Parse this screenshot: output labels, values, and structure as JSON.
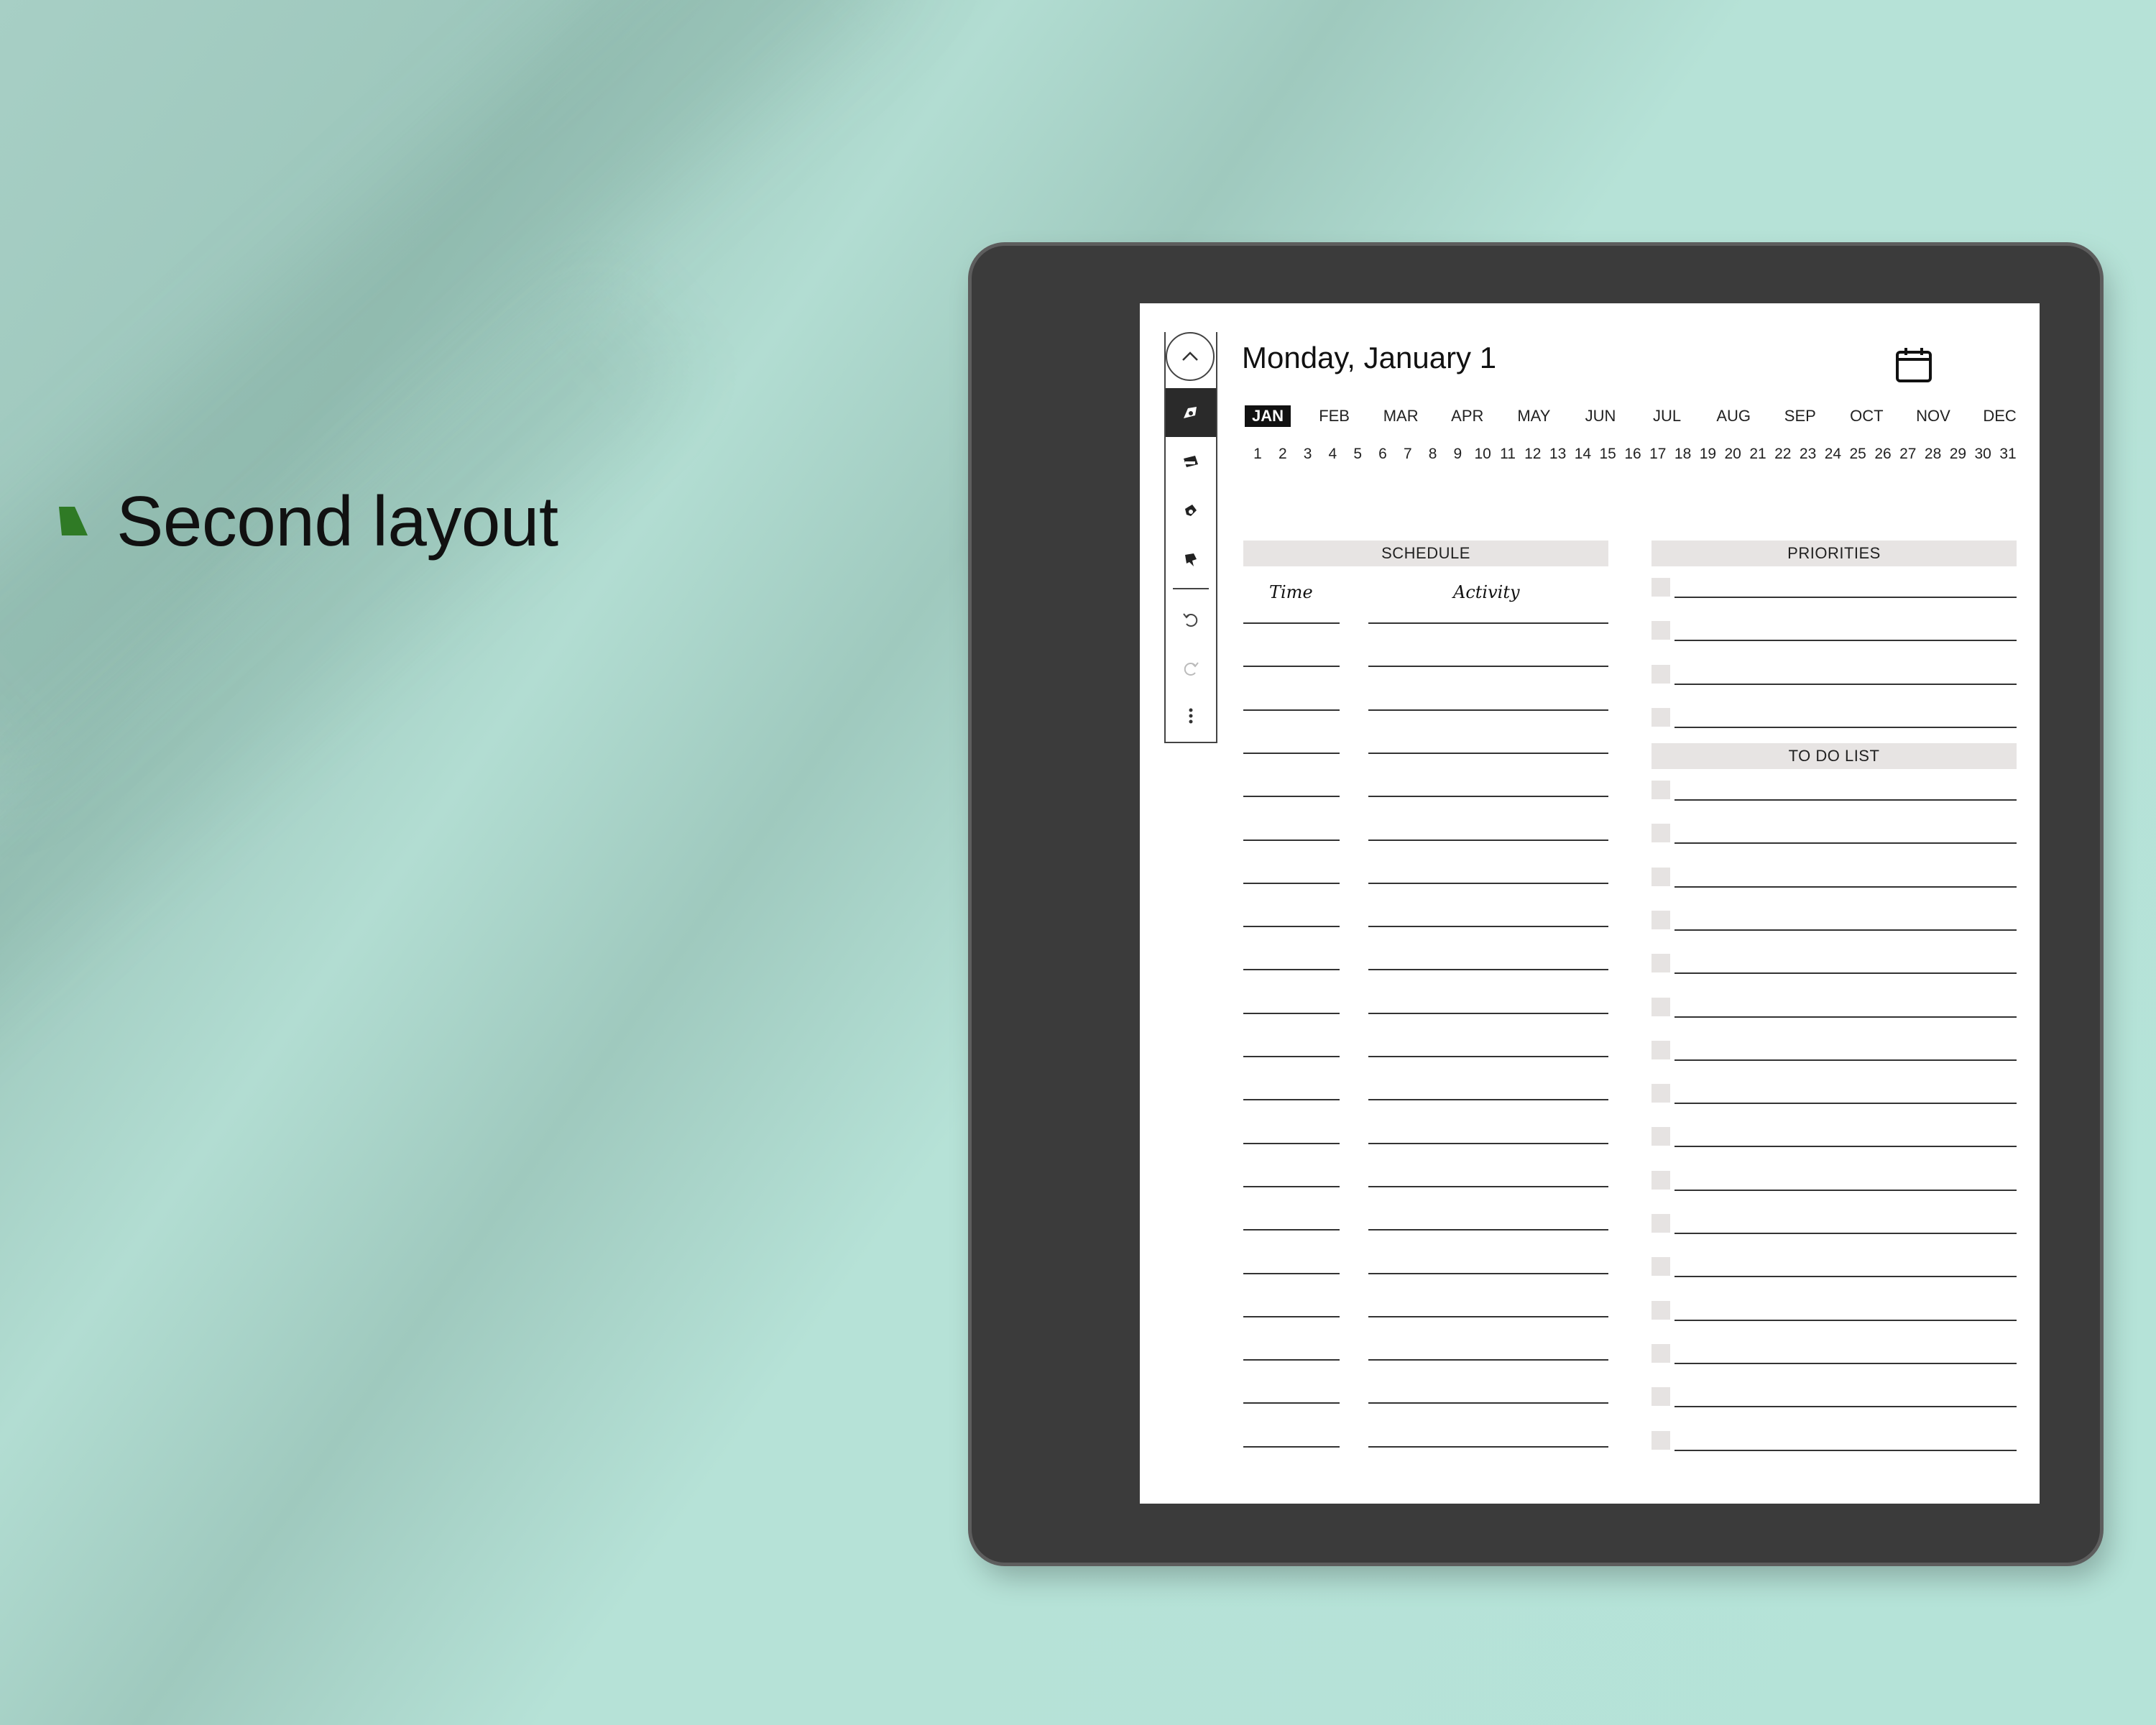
{
  "caption": {
    "text": "Second layout"
  },
  "planner": {
    "title": "Monday, January 1",
    "months": [
      "JAN",
      "FEB",
      "MAR",
      "APR",
      "MAY",
      "JUN",
      "JUL",
      "AUG",
      "SEP",
      "OCT",
      "NOV",
      "DEC"
    ],
    "selected_month": "JAN",
    "days": [
      "1",
      "2",
      "3",
      "4",
      "5",
      "6",
      "7",
      "8",
      "9",
      "10",
      "11",
      "12",
      "13",
      "14",
      "15",
      "16",
      "17",
      "18",
      "19",
      "20",
      "21",
      "22",
      "23",
      "24",
      "25",
      "26",
      "27",
      "28",
      "29",
      "30",
      "31"
    ],
    "schedule": {
      "label": "SCHEDULE",
      "time_label": "Time",
      "activity_label": "Activity",
      "rows": 20
    },
    "priorities": {
      "label": "PRIORITIES",
      "rows": 4
    },
    "todo": {
      "label": "TO DO LIST",
      "rows": 16
    }
  },
  "toolbar": {
    "items": [
      "chevron-up-icon",
      "pen-icon",
      "highlighter-icon",
      "eraser-icon",
      "lasso-icon",
      "undo-icon",
      "redo-icon",
      "more-icon"
    ]
  },
  "colors": {
    "background": "#b5e3d8",
    "device": "#3b3b3b",
    "header_fill": "#e7e4e3",
    "bullet": "#2f7a25"
  }
}
